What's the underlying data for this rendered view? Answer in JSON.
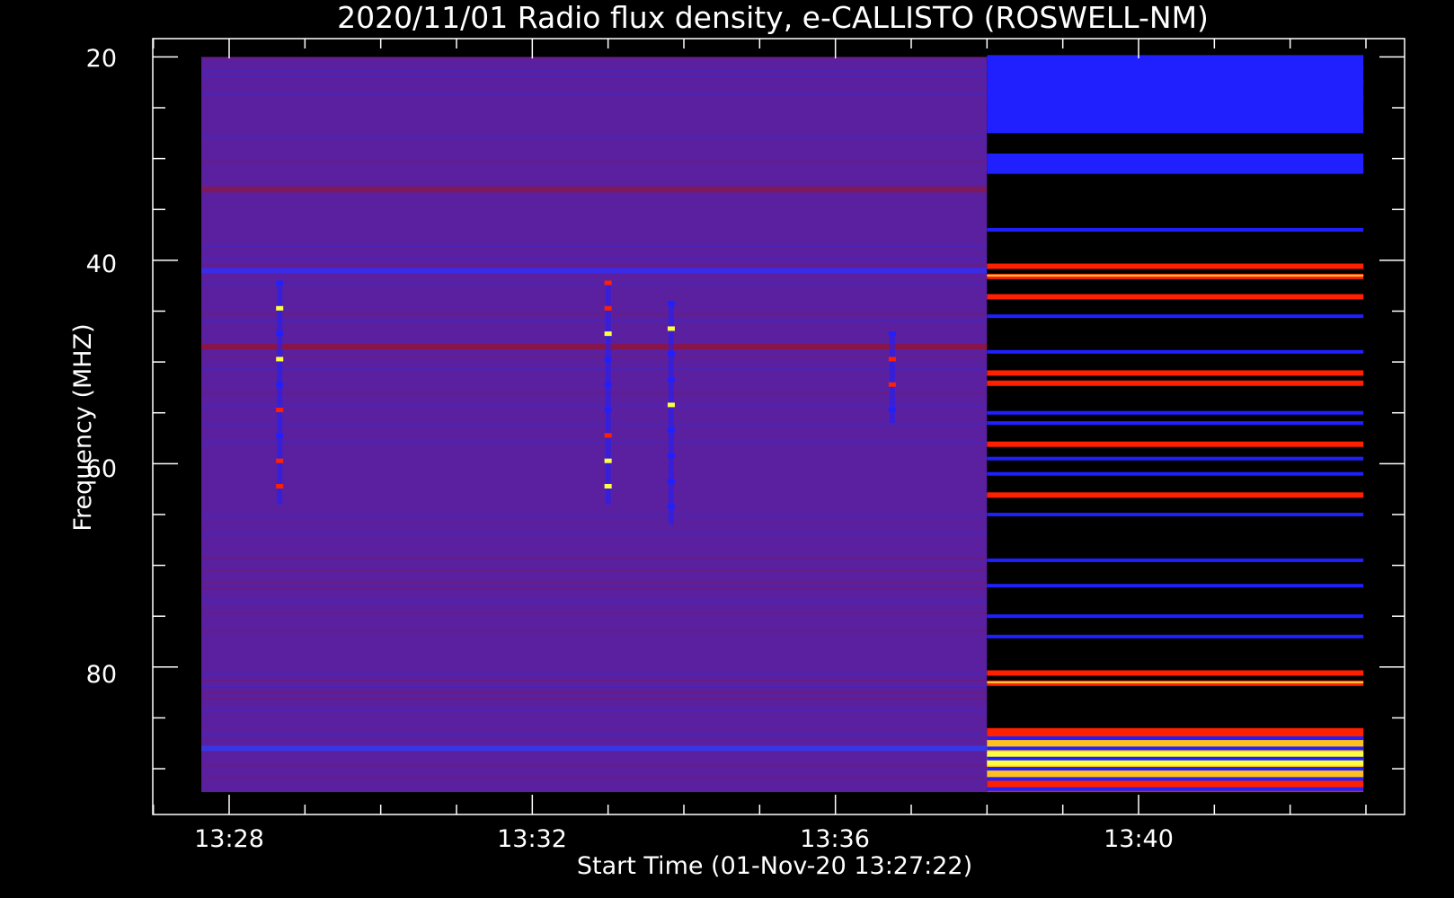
{
  "chart_data": {
    "type": "heatmap",
    "title": "2020/11/01  Radio flux density, e-CALLISTO (ROSWELL-NM)",
    "xlabel": "Start Time (01-Nov-20 13:27:22)",
    "ylabel": "Frequency (MHZ)",
    "x_ticks": [
      "13:28",
      "13:32",
      "13:36",
      "13:40"
    ],
    "y_ticks": [
      20,
      40,
      60,
      80
    ],
    "ylim": [
      18.2,
      94.5
    ],
    "y_inverted": true,
    "x_range_minutes": [
      13.363,
      13.73
    ],
    "data_x_range": [
      "13:27:38",
      "13:42:58"
    ],
    "data_y_range": [
      20,
      92.3
    ],
    "bursts": [
      {
        "time": "13:28:40",
        "freq_range": [
          42,
          64
        ]
      },
      {
        "time": "13:33:00",
        "freq_range": [
          42,
          64
        ]
      },
      {
        "time": "13:33:50",
        "freq_range": [
          44,
          66
        ]
      },
      {
        "time": "13:36:45",
        "freq_range": [
          47,
          56
        ]
      }
    ],
    "rfi_bands_mhz": [
      20,
      21,
      22.5,
      24,
      26,
      27,
      30,
      31,
      37,
      40.5,
      41.5,
      43.5,
      45.5,
      49,
      51,
      52,
      55,
      56,
      58,
      59.5,
      61,
      63,
      65,
      69.5,
      72,
      75,
      77,
      80.5,
      81.5,
      87,
      88,
      89,
      90,
      91,
      92
    ],
    "colors": {
      "background": "#000000",
      "noise_floor": "#5a20a0",
      "low": "#2020ff",
      "mid": "#ff2000",
      "high": "#ffff40"
    }
  }
}
